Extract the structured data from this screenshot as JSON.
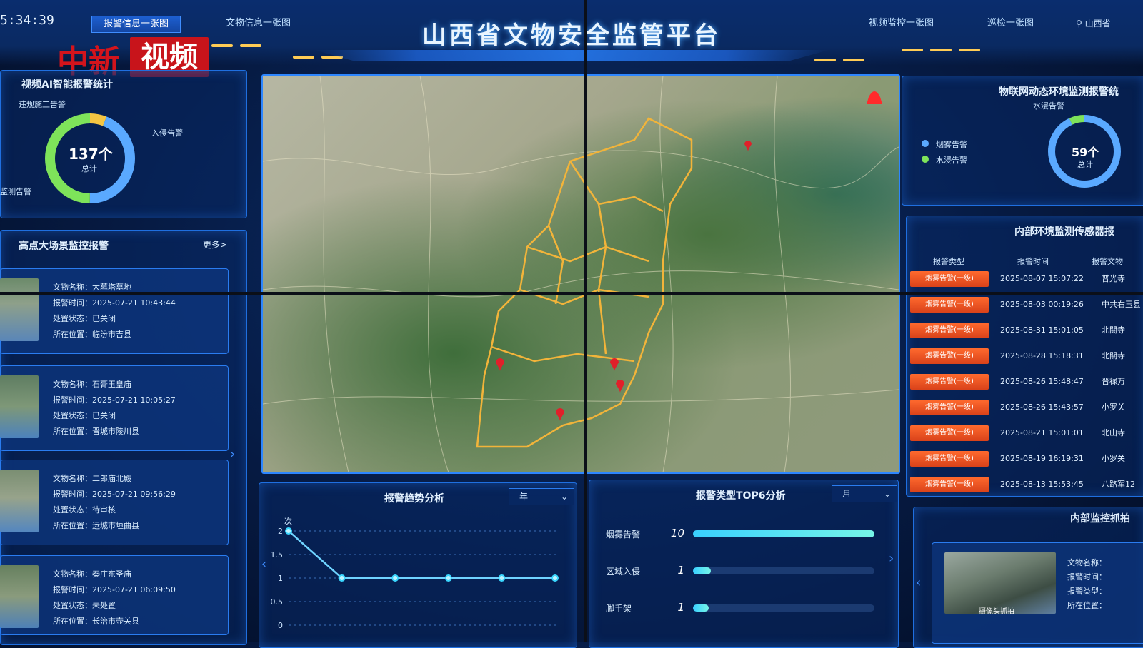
{
  "header": {
    "clock": "5:34:39",
    "nav_left": [
      {
        "label": "报警信息一张图",
        "active": true
      },
      {
        "label": "文物信息一张图",
        "active": false
      }
    ],
    "title": "山西省文物安全监管平台",
    "nav_right": [
      {
        "label": "视频监控一张图"
      },
      {
        "label": "巡检一张图"
      }
    ],
    "location": "山西省"
  },
  "watermark": {
    "red_text": "中新",
    "box_text": "视频"
  },
  "ai_stats": {
    "title": "视频AI智能报警统计",
    "total_value": "137个",
    "total_label": "总计",
    "labels": [
      "违规施工告警",
      "入侵告警",
      "监测告警"
    ],
    "segments": [
      {
        "name": "违规施工告警",
        "fraction": 0.06,
        "color": "#f5c542"
      },
      {
        "name": "入侵告警",
        "fraction": 0.44,
        "color": "#5aa9ff"
      },
      {
        "name": "监测告警",
        "fraction": 0.5,
        "color": "#7ee35a"
      }
    ]
  },
  "high_point": {
    "title": "高点大场景监控报警",
    "more": "更多>",
    "cards": [
      {
        "lines": [
          "文物名称：大墓塔墓地",
          "报警时间：2025-07-21 10:43:44",
          "处置状态：已关闭",
          "所在位置：临汾市吉县"
        ]
      },
      {
        "lines": [
          "文物名称：石膏玉皇庙",
          "报警时间：2025-07-21 10:05:27",
          "处置状态：已关闭",
          "所在位置：晋城市陵川县"
        ]
      },
      {
        "lines": [
          "文物名称：二郎庙北殿",
          "报警时间：2025-07-21 09:56:29",
          "处置状态：待审核",
          "所在位置：运城市垣曲县"
        ]
      },
      {
        "lines": [
          "文物名称：秦庄东圣庙",
          "报警时间：2025-07-21 06:09:50",
          "处置状态：未处置",
          "所在位置：长治市壶关县"
        ]
      }
    ]
  },
  "iot": {
    "title": "物联网动态环境监测报警统",
    "top_label": "水浸告警",
    "legend": [
      "烟雾告警",
      "水浸告警"
    ],
    "legend_colors": [
      "#5aa9ff",
      "#7ee35a"
    ],
    "total_value": "59个",
    "total_label": "总计",
    "segments": [
      {
        "name": "烟雾告警",
        "fraction": 0.93,
        "color": "#5aa9ff"
      },
      {
        "name": "水浸告警",
        "fraction": 0.07,
        "color": "#7ee35a"
      }
    ]
  },
  "sensor": {
    "title": "内部环境监测传感器报",
    "columns": [
      "报警类型",
      "报警时间",
      "报警文物"
    ],
    "rows": [
      {
        "type": "烟雾告警(一级)",
        "time": "2025-08-07 15:07:22",
        "loc": "普光寺"
      },
      {
        "type": "烟雾告警(一级)",
        "time": "2025-08-03 00:19:26",
        "loc": "中共右玉县"
      },
      {
        "type": "烟雾告警(一级)",
        "time": "2025-08-31 15:01:05",
        "loc": "北關寺"
      },
      {
        "type": "烟雾告警(一级)",
        "time": "2025-08-28 15:18:31",
        "loc": "北關寺"
      },
      {
        "type": "烟雾告警(一级)",
        "time": "2025-08-26 15:48:47",
        "loc": "晋禄万"
      },
      {
        "type": "烟雾告警(一级)",
        "time": "2025-08-26 15:43:57",
        "loc": "小罗关"
      },
      {
        "type": "烟雾告警(一级)",
        "time": "2025-08-21 15:01:01",
        "loc": "北山寺"
      },
      {
        "type": "烟雾告警(一级)",
        "time": "2025-08-19 16:19:31",
        "loc": "小罗关"
      },
      {
        "type": "烟雾告警(一级)",
        "time": "2025-08-13 15:53:45",
        "loc": "八路军12"
      }
    ]
  },
  "trend": {
    "title": "报警趋势分析",
    "select": "年",
    "y_unit": "次"
  },
  "chart_data": {
    "type": "line",
    "ylabel": "次",
    "y_ticks": [
      0,
      0.5,
      1,
      1.5,
      2
    ],
    "ylim": [
      0,
      2
    ],
    "series": [
      {
        "values": [
          2,
          1,
          1,
          1,
          1,
          1
        ]
      }
    ],
    "x": [
      1,
      2,
      3,
      4,
      5,
      6
    ]
  },
  "top6": {
    "title": "报警类型TOP6分析",
    "select": "月",
    "items": [
      {
        "label": "烟雾告警",
        "value": "10",
        "fraction": 1.0
      },
      {
        "label": "区域入侵",
        "value": "1",
        "fraction": 0.1
      },
      {
        "label": "脚手架",
        "value": "1",
        "fraction": 0.06
      }
    ]
  },
  "snapshot": {
    "title": "内部监控抓拍",
    "thumb_label": "摄像头抓拍",
    "lines": [
      "文物名称：",
      "报警时间：",
      "报警类型：",
      "所在位置："
    ]
  }
}
